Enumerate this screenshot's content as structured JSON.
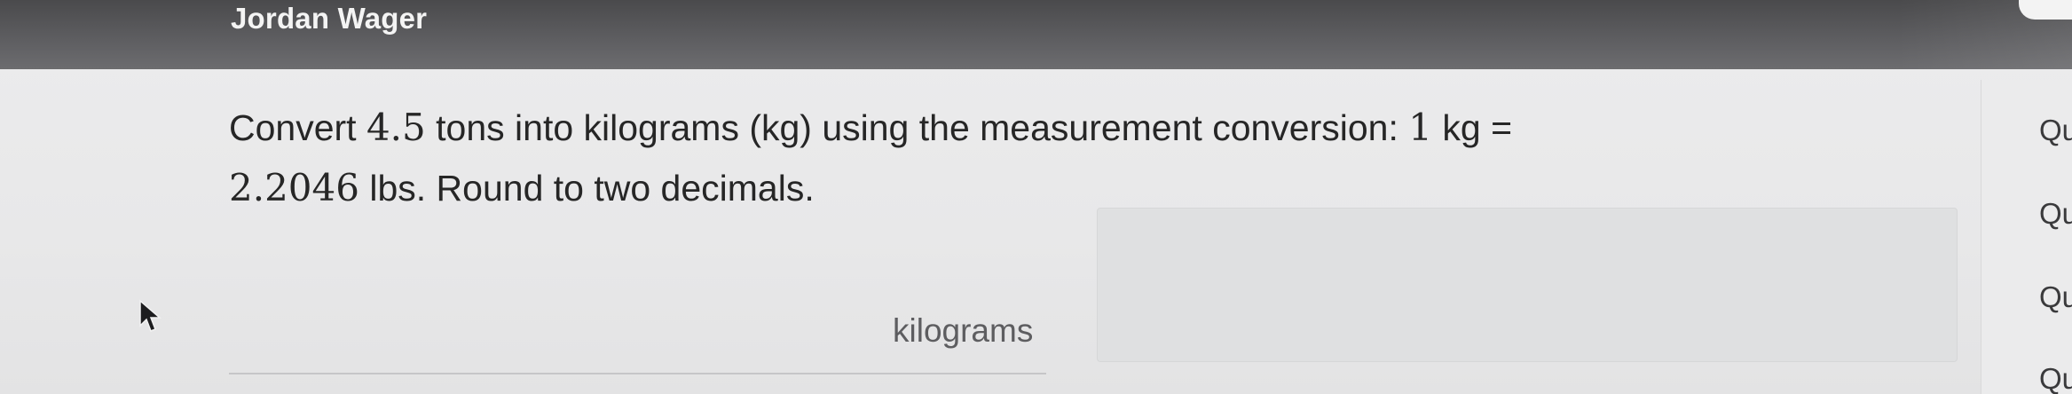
{
  "header": {
    "user_name": "Jordan Wager"
  },
  "question": {
    "text_1": "Convert ",
    "amount": "4.5",
    "text_2": " tons into kilograms (kg) using the measurement conversion: ",
    "conv_left": "1",
    "conv_unit": " kg =",
    "conv_right": "2.2046",
    "text_3": " lbs. Round to two decimals."
  },
  "answer": {
    "value": "",
    "unit": "kilograms"
  },
  "sidebar": {
    "items": [
      "Qu",
      "Qu",
      "Qu",
      "Qu"
    ]
  },
  "colors": {
    "header_bg": "#5d5d60",
    "page_bg": "#e9e9ea",
    "text": "#262626"
  }
}
